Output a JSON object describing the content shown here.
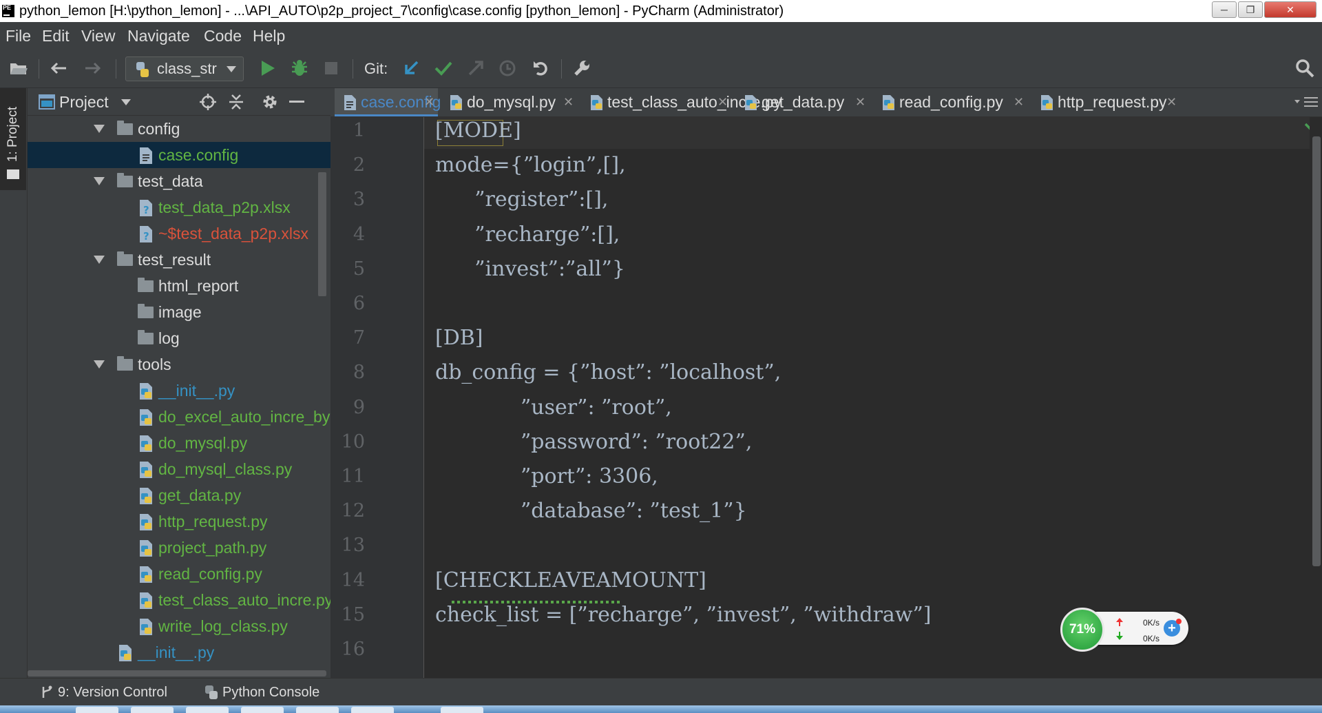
{
  "window": {
    "title": "python_lemon [H:\\python_lemon] - ...\\API_AUTO\\p2p_project_7\\config\\case.config [python_lemon] - PyCharm (Administrator)",
    "app_badge": "PE"
  },
  "menu": [
    "File",
    "Edit",
    "View",
    "Navigate",
    "Code",
    "Help"
  ],
  "toolbar": {
    "run_config": "class_str",
    "git_label": "Git:"
  },
  "left_strip": {
    "project_tab": "1: Project"
  },
  "project_panel": {
    "title": "Project",
    "tree": [
      {
        "label": "config",
        "type": "folder",
        "color": "#dddddd"
      },
      {
        "label": "case.config",
        "type": "config",
        "color": "#62b543",
        "selected": true
      },
      {
        "label": "test_data",
        "type": "folder",
        "color": "#dddddd"
      },
      {
        "label": "test_data_p2p.xlsx",
        "type": "unknown",
        "color": "#62b543"
      },
      {
        "label": "~$test_data_p2p.xlsx",
        "type": "unknown",
        "color": "#d9523b"
      },
      {
        "label": "test_result",
        "type": "folder",
        "color": "#dddddd"
      },
      {
        "label": "html_report",
        "type": "folder",
        "color": "#dddddd"
      },
      {
        "label": "image",
        "type": "folder",
        "color": "#dddddd"
      },
      {
        "label": "log",
        "type": "folder",
        "color": "#dddddd"
      },
      {
        "label": "tools",
        "type": "folder",
        "color": "#dddddd"
      },
      {
        "label": "__init__.py",
        "type": "python",
        "color": "#3592c4"
      },
      {
        "label": "do_excel_auto_incre_by",
        "type": "python",
        "color": "#62b543"
      },
      {
        "label": "do_mysql.py",
        "type": "python",
        "color": "#62b543"
      },
      {
        "label": "do_mysql_class.py",
        "type": "python",
        "color": "#62b543"
      },
      {
        "label": "get_data.py",
        "type": "python",
        "color": "#62b543"
      },
      {
        "label": "http_request.py",
        "type": "python",
        "color": "#62b543"
      },
      {
        "label": "project_path.py",
        "type": "python",
        "color": "#62b543"
      },
      {
        "label": "read_config.py",
        "type": "python",
        "color": "#62b543"
      },
      {
        "label": "test_class_auto_incre.py",
        "type": "python",
        "color": "#62b543"
      },
      {
        "label": "write_log_class.py",
        "type": "python",
        "color": "#62b543"
      },
      {
        "label": "__init__.py",
        "type": "python",
        "color": "#3592c4"
      }
    ]
  },
  "editor": {
    "tabs": [
      {
        "label": "case.config",
        "active": true,
        "type": "config"
      },
      {
        "label": "do_mysql.py",
        "active": false,
        "type": "python"
      },
      {
        "label": "test_class_auto_incre.py",
        "active": false,
        "type": "python"
      },
      {
        "label": "get_data.py",
        "active": false,
        "type": "python"
      },
      {
        "label": "read_config.py",
        "active": false,
        "type": "python"
      },
      {
        "label": "http_request.py",
        "active": false,
        "type": "python"
      }
    ],
    "line_numbers": [
      "1",
      "2",
      "3",
      "4",
      "5",
      "6",
      "7",
      "8",
      "9",
      "10",
      "11",
      "12",
      "13",
      "14",
      "15",
      "16"
    ],
    "lines": [
      "[MODE]",
      "mode={”login”,[],",
      "      ”register”:[],",
      "      ”recharge”:[],",
      "      ”invest”:”all”}",
      "",
      "[DB]",
      "db_config = {”host”: ”localhost”,",
      "             ”user”: ”root”,",
      "             ”password”: ”root22”,",
      "             ”port”: 3306,",
      "             ”database”: ”test_1”}",
      "",
      "[CHECKLEAVEAMOUNT]",
      "check_list = [”recharge”, ”invest”, ”withdraw”]",
      ""
    ]
  },
  "network_widget": {
    "percent": "71%",
    "upload": "0K/s",
    "download": "0K/s"
  },
  "bottom_bar": {
    "version_control": "9: Version Control",
    "python_console": "Python Console"
  },
  "colors": {
    "accent": "#4a88c7",
    "added_file": "#62b543",
    "unversioned_file": "#d9523b",
    "python_file": "#3592c4",
    "run_green": "#499c54"
  }
}
